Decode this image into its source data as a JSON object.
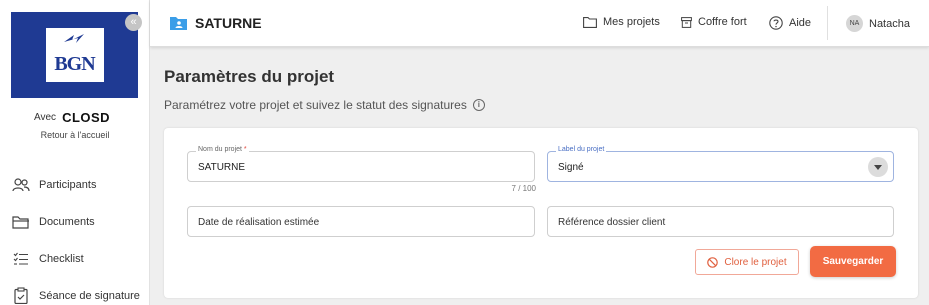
{
  "sidebar": {
    "logo_text": "BGN",
    "collapse_icon": "«",
    "avec_label": "Avec",
    "brand": "CLOSD",
    "retour": "Retour à l'accueil",
    "items": [
      {
        "label": "Participants",
        "icon": "people-icon"
      },
      {
        "label": "Documents",
        "icon": "folder-icon"
      },
      {
        "label": "Checklist",
        "icon": "checklist-icon"
      },
      {
        "label": "Séance de signature",
        "icon": "clipboard-icon"
      }
    ]
  },
  "header": {
    "project_name": "SATURNE",
    "links": [
      {
        "label": "Mes projets",
        "icon": "folder-outline-icon"
      },
      {
        "label": "Coffre fort",
        "icon": "archive-icon"
      },
      {
        "label": "Aide",
        "icon": "help-icon"
      }
    ],
    "user": {
      "initials": "NA",
      "name": "Natacha"
    }
  },
  "page": {
    "title": "Paramètres du projet",
    "subtitle": "Paramétrez votre projet et suivez le statut des signatures",
    "info_icon": "i"
  },
  "form": {
    "project_name_label": "Nom du projet",
    "required_mark": "*",
    "project_name_value": "SATURNE",
    "char_counter": "7 / 100",
    "status_label": "Label du projet",
    "status_value": "Signé",
    "date_placeholder": "Date de réalisation estimée",
    "reference_placeholder": "Référence dossier client",
    "close_button": "Clore le projet",
    "save_button": "Sauvegarder"
  },
  "colors": {
    "logo_bg": "#1f3a93",
    "accent": "#f26b43",
    "folder_blue": "#3b9ee8"
  }
}
